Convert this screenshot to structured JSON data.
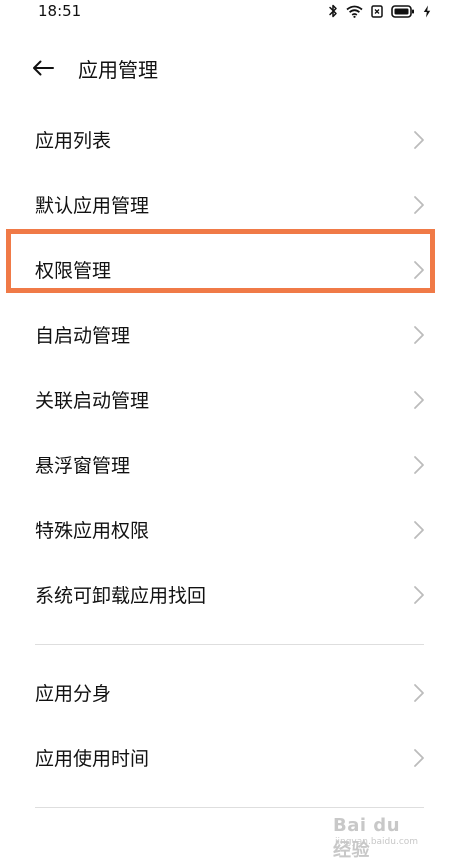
{
  "status_bar": {
    "time": "18:51",
    "icons": [
      "bluetooth-icon",
      "wifi-icon",
      "sim-icon",
      "battery-icon",
      "charging-icon"
    ]
  },
  "header": {
    "back_icon": "back-arrow-icon",
    "title": "应用管理"
  },
  "menu": {
    "group1": [
      {
        "label": "应用列表"
      },
      {
        "label": "默认应用管理"
      },
      {
        "label": "权限管理"
      },
      {
        "label": "自启动管理"
      },
      {
        "label": "关联启动管理"
      },
      {
        "label": "悬浮窗管理"
      },
      {
        "label": "特殊应用权限"
      },
      {
        "label": "系统可卸载应用找回"
      }
    ],
    "group2": [
      {
        "label": "应用分身"
      },
      {
        "label": "应用使用时间"
      }
    ]
  },
  "highlighted_item": "权限管理",
  "colors": {
    "highlight_border": "#f07a47",
    "chevron": "#bcbcbc",
    "divider": "#dedede"
  },
  "watermark": {
    "text": "Bai du 经验",
    "subtext": "jingyan.baidu.com"
  }
}
